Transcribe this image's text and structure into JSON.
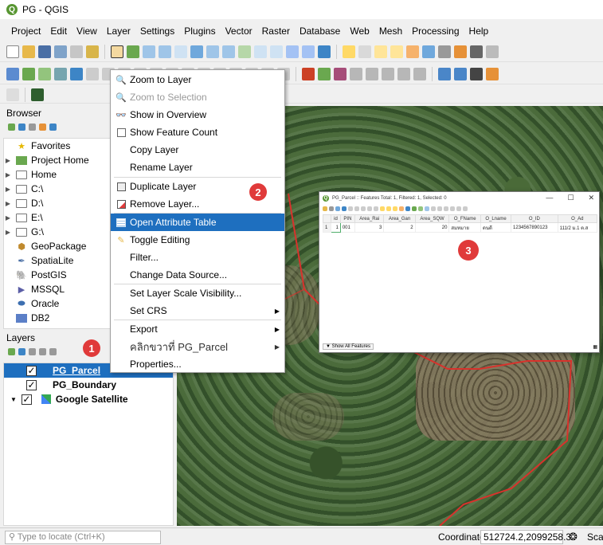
{
  "window": {
    "title": "PG - QGIS"
  },
  "menu": [
    "Project",
    "Edit",
    "View",
    "Layer",
    "Settings",
    "Plugins",
    "Vector",
    "Raster",
    "Database",
    "Web",
    "Mesh",
    "Processing",
    "Help"
  ],
  "browser": {
    "title": "Browser",
    "items": [
      {
        "label": "Favorites",
        "icon": "star-icon",
        "arrow": ""
      },
      {
        "label": "Project Home",
        "icon": "project-home-icon",
        "arrow": "▶"
      },
      {
        "label": "Home",
        "icon": "home-icon",
        "arrow": "▶"
      },
      {
        "label": "C:\\",
        "icon": "folder-icon",
        "arrow": "▶"
      },
      {
        "label": "D:\\",
        "icon": "folder-icon",
        "arrow": "▶"
      },
      {
        "label": "E:\\",
        "icon": "folder-icon",
        "arrow": "▶"
      },
      {
        "label": "G:\\",
        "icon": "folder-icon",
        "arrow": "▶"
      },
      {
        "label": "GeoPackage",
        "icon": "geopackage-icon",
        "arrow": ""
      },
      {
        "label": "SpatiaLite",
        "icon": "spatialite-icon",
        "arrow": ""
      },
      {
        "label": "PostGIS",
        "icon": "postgis-icon",
        "arrow": ""
      },
      {
        "label": "MSSQL",
        "icon": "mssql-icon",
        "arrow": ""
      },
      {
        "label": "Oracle",
        "icon": "oracle-icon",
        "arrow": ""
      },
      {
        "label": "DB2",
        "icon": "db2-icon",
        "arrow": ""
      }
    ]
  },
  "layers": {
    "title": "Layers",
    "items": [
      {
        "label": "PG_Parcel",
        "checked": "✓",
        "selected": true
      },
      {
        "label": "PG_Boundary",
        "checked": "✓",
        "selected": false
      },
      {
        "label": "Google Satellite",
        "checked": "✓",
        "selected": false
      }
    ]
  },
  "context_menu": {
    "items": [
      {
        "label": "Zoom to Layer",
        "icon": "zoom-to-layer-icon",
        "disabled": false,
        "highlight": false,
        "submenu": false
      },
      {
        "label": "Zoom to Selection",
        "icon": "zoom-to-selection-icon",
        "disabled": true,
        "highlight": false,
        "submenu": false
      },
      {
        "label": "Show in Overview",
        "icon": "overview-glasses-icon",
        "disabled": false,
        "highlight": false,
        "submenu": false
      },
      {
        "label": "Show Feature Count",
        "icon": "checkbox-icon",
        "disabled": false,
        "highlight": false,
        "submenu": false
      },
      {
        "label": "Copy Layer",
        "icon": "",
        "disabled": false,
        "highlight": false,
        "submenu": false
      },
      {
        "label": "Rename Layer",
        "icon": "",
        "disabled": false,
        "highlight": false,
        "submenu": false
      },
      {
        "label": "Duplicate Layer",
        "icon": "duplicate-layer-icon",
        "disabled": false,
        "highlight": false,
        "submenu": false
      },
      {
        "label": "Remove Layer...",
        "icon": "remove-layer-icon",
        "disabled": false,
        "highlight": false,
        "submenu": false
      },
      {
        "label": "Open Attribute Table",
        "icon": "attribute-table-icon",
        "disabled": false,
        "highlight": true,
        "submenu": false
      },
      {
        "label": "Toggle Editing",
        "icon": "pencil-icon",
        "disabled": false,
        "highlight": false,
        "submenu": false
      },
      {
        "label": "Filter...",
        "icon": "",
        "disabled": false,
        "highlight": false,
        "submenu": false
      },
      {
        "label": "Change Data Source...",
        "icon": "",
        "disabled": false,
        "highlight": false,
        "submenu": false
      },
      {
        "label": "Set Layer Scale Visibility...",
        "icon": "",
        "disabled": false,
        "highlight": false,
        "submenu": false
      },
      {
        "label": "Set CRS",
        "icon": "",
        "disabled": false,
        "highlight": false,
        "submenu": true
      },
      {
        "label": "Export",
        "icon": "",
        "disabled": false,
        "highlight": false,
        "submenu": true
      },
      {
        "label": "คลิกขวาที่ PG_Parcel",
        "icon": "",
        "disabled": false,
        "highlight": false,
        "submenu": true
      },
      {
        "label": "Properties...",
        "icon": "",
        "disabled": false,
        "highlight": false,
        "submenu": false
      }
    ]
  },
  "badges": [
    "1",
    "2",
    "3"
  ],
  "attribute_table": {
    "title": "PG_Parcel :: Features Total: 1, Filtered: 1, Selected: 0",
    "columns": [
      "id",
      "PIN",
      "Area_Rai",
      "Area_Gan",
      "Area_SQW",
      "O_FName",
      "O_Lname",
      "O_ID",
      "O_Ad"
    ],
    "rows": [
      [
        "1",
        "001",
        "3",
        "2",
        "20",
        "สมหมาย",
        "ดนดี",
        "1234567890123",
        "111/2 ม.1 ต.ส"
      ]
    ],
    "row_numbers": [
      "1"
    ],
    "footer": "Show All Features"
  },
  "status": {
    "locate_placeholder": "Type to locate (Ctrl+K)",
    "coordinate_label": "Coordinate",
    "coordinate_value": "512724.2,2099258.3",
    "scale_label": "Scal"
  },
  "colors": {
    "highlight": "#1e6fbf",
    "badge": "#e03a3a",
    "boundary": "#d8322c"
  }
}
